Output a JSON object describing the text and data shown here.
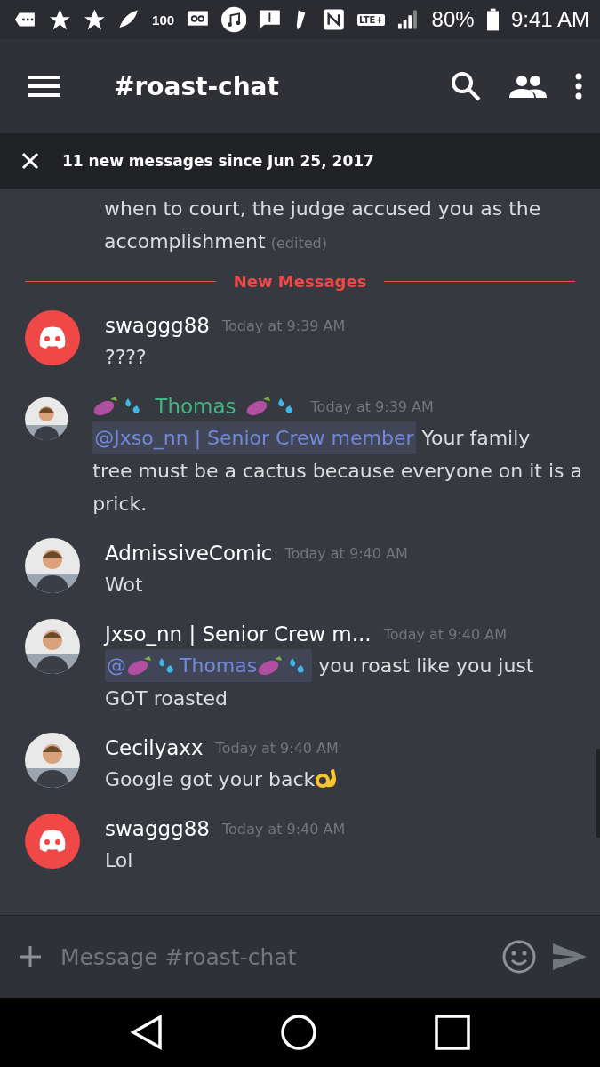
{
  "status_bar": {
    "notification_count": "100",
    "network": "LTE+",
    "battery": "80%",
    "time": "9:41 AM"
  },
  "header": {
    "channel": "#roast-chat"
  },
  "banner": {
    "text": "11 new messages since Jun 25, 2017"
  },
  "previous_message": {
    "lines": [
      "when to court, the judge accused you as the",
      "accomplishment"
    ],
    "edited": "(edited)"
  },
  "divider": {
    "label": "New Messages"
  },
  "messages": [
    {
      "avatar": {
        "kind": "logo"
      },
      "author": {
        "name": "swaggg88",
        "decorated": false,
        "color": "#ffffff"
      },
      "time": "Today at 9:39 AM",
      "lines": [
        {
          "text": "????"
        }
      ]
    },
    {
      "avatar": {
        "kind": "picture"
      },
      "author": {
        "name": "Thomas",
        "decorated": true,
        "color": "#43b581"
      },
      "time": "Today at 9:39 AM",
      "lines": [
        {
          "mention_prefix": "@",
          "mention": "Jxso_nn | Senior Crew member",
          "mention_decorated": false,
          "text": " Your family"
        },
        {
          "text": "tree must be a cactus because everyone on it is a"
        },
        {
          "text": "prick."
        }
      ]
    },
    {
      "avatar": {
        "kind": "picture"
      },
      "author": {
        "name": "AdmissiveComic",
        "decorated": false,
        "color": "#ffffff"
      },
      "time": "Today at 9:40 AM",
      "lines": [
        {
          "text": "Wot"
        }
      ]
    },
    {
      "avatar": {
        "kind": "picture"
      },
      "author": {
        "name": "Jxso_nn | Senior Crew m...",
        "decorated": false,
        "color": "#ffffff"
      },
      "time": "Today at 9:40 AM",
      "lines": [
        {
          "mention_prefix": "@",
          "mention": "Thomas",
          "mention_decorated": true,
          "text": " you roast like you just"
        },
        {
          "text": "GOT roasted"
        }
      ]
    },
    {
      "avatar": {
        "kind": "picture"
      },
      "author": {
        "name": "Cecilyaxx",
        "decorated": false,
        "color": "#ffffff"
      },
      "time": "Today at 9:40 AM",
      "lines": [
        {
          "text": "Google got your back",
          "ok_hand": true
        }
      ]
    },
    {
      "avatar": {
        "kind": "logo"
      },
      "author": {
        "name": "swaggg88",
        "decorated": false,
        "color": "#ffffff"
      },
      "time": "Today at 9:40 AM",
      "lines": [
        {
          "text": "Lol"
        }
      ]
    }
  ],
  "composer": {
    "placeholder": "Message #roast-chat"
  }
}
